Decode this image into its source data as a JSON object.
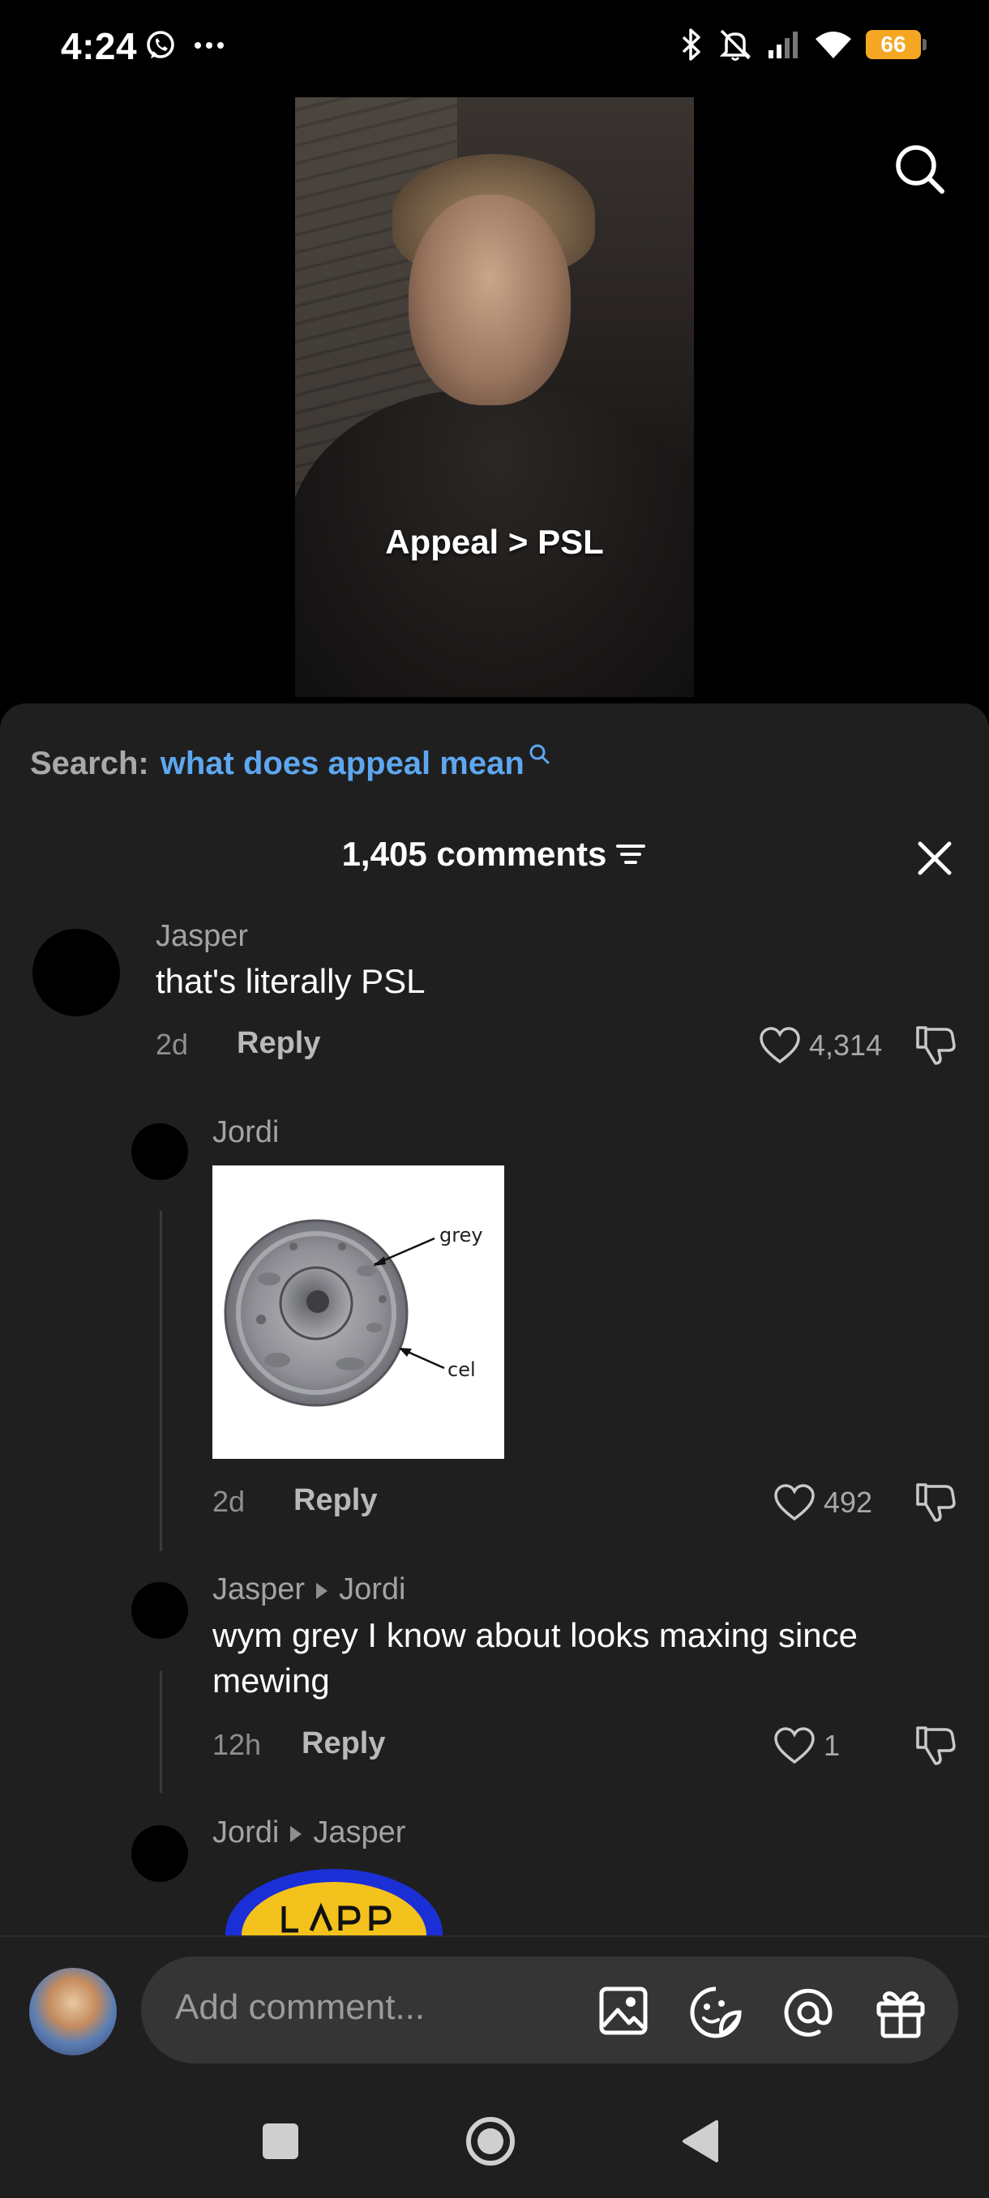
{
  "status": {
    "time": "4:24",
    "battery": "66"
  },
  "video": {
    "caption": "Appeal > PSL"
  },
  "search_suggestion": {
    "label": "Search:",
    "query": "what does appeal mean"
  },
  "comments_header": {
    "count": "1,405 comments"
  },
  "comments": [
    {
      "author": "Jasper",
      "text": "that's literally PSL",
      "age": "2d",
      "reply_label": "Reply",
      "likes": "4,314"
    },
    {
      "author": "Jordi",
      "image_labels": [
        "grey",
        "cel"
      ],
      "age": "2d",
      "reply_label": "Reply",
      "likes": "492"
    },
    {
      "author": "Jasper",
      "reply_to": "Jordi",
      "text": "wym grey I know about looks maxing since mewing",
      "age": "12h",
      "reply_label": "Reply",
      "likes": "1"
    },
    {
      "author": "Jordi",
      "reply_to": "Jasper"
    }
  ],
  "composer": {
    "placeholder": "Add comment..."
  },
  "colors": {
    "accent_link": "#5ea7f0",
    "sheet_bg": "#1f1f1f",
    "battery": "#f5a623"
  }
}
